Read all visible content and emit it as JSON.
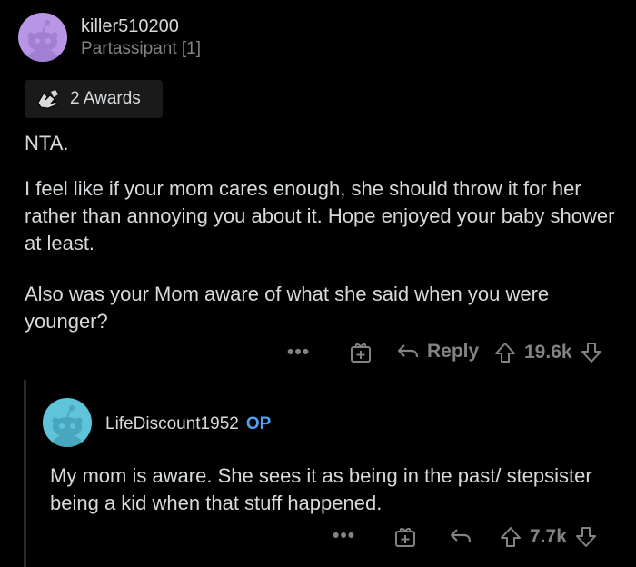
{
  "comment": {
    "username": "killer510200",
    "flair": "Partassipant [1]",
    "awards_label": "2 Awards",
    "paragraphs": [
      "NTA.",
      "I feel like if your mom cares enough, she should throw it for her rather than annoying you about it. Hope enjoyed your baby shower at least.",
      "Also was your Mom aware of what she said when you were younger?"
    ],
    "actions": {
      "more": "•••",
      "reply": "Reply",
      "votes": "19.6k"
    },
    "avatar_color": "#b995e6"
  },
  "reply": {
    "username": "LifeDiscount1952",
    "op_label": "OP",
    "paragraphs": [
      "My mom is aware. She sees it as being in the past/ stepsister being a kid when that stuff happened."
    ],
    "actions": {
      "more": "•••",
      "votes": "7.7k"
    },
    "avatar_color": "#5fc3d9"
  },
  "colors": {
    "background": "#000000",
    "text": "#d7dadc",
    "muted": "#818384",
    "op_blue": "#4fa3f7"
  }
}
